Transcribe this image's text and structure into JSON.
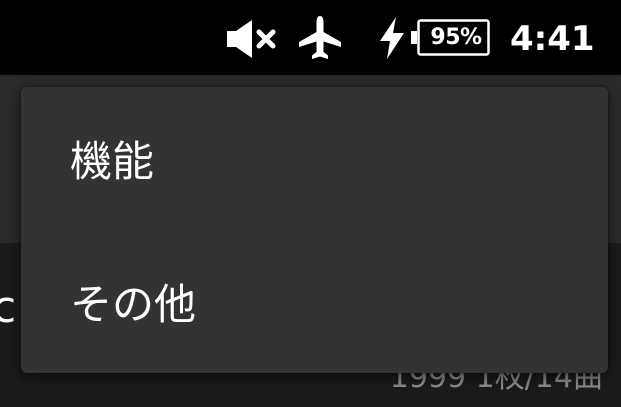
{
  "status_bar": {
    "icons": [
      "volume-muted-icon",
      "airplane-mode-icon",
      "charging-bolt-icon",
      "battery-icon"
    ],
    "battery_level": "95%",
    "time": "4:41"
  },
  "background": {
    "title": "c",
    "subtitle": "1999 1枚/14曲"
  },
  "menu": {
    "items": [
      {
        "label": "機能"
      },
      {
        "label": "その他"
      }
    ]
  },
  "colors": {
    "status_bar_bg": "#000000",
    "menu_bg": "#333333",
    "text": "#ffffff",
    "subtitle_text": "#8e8e8e"
  }
}
